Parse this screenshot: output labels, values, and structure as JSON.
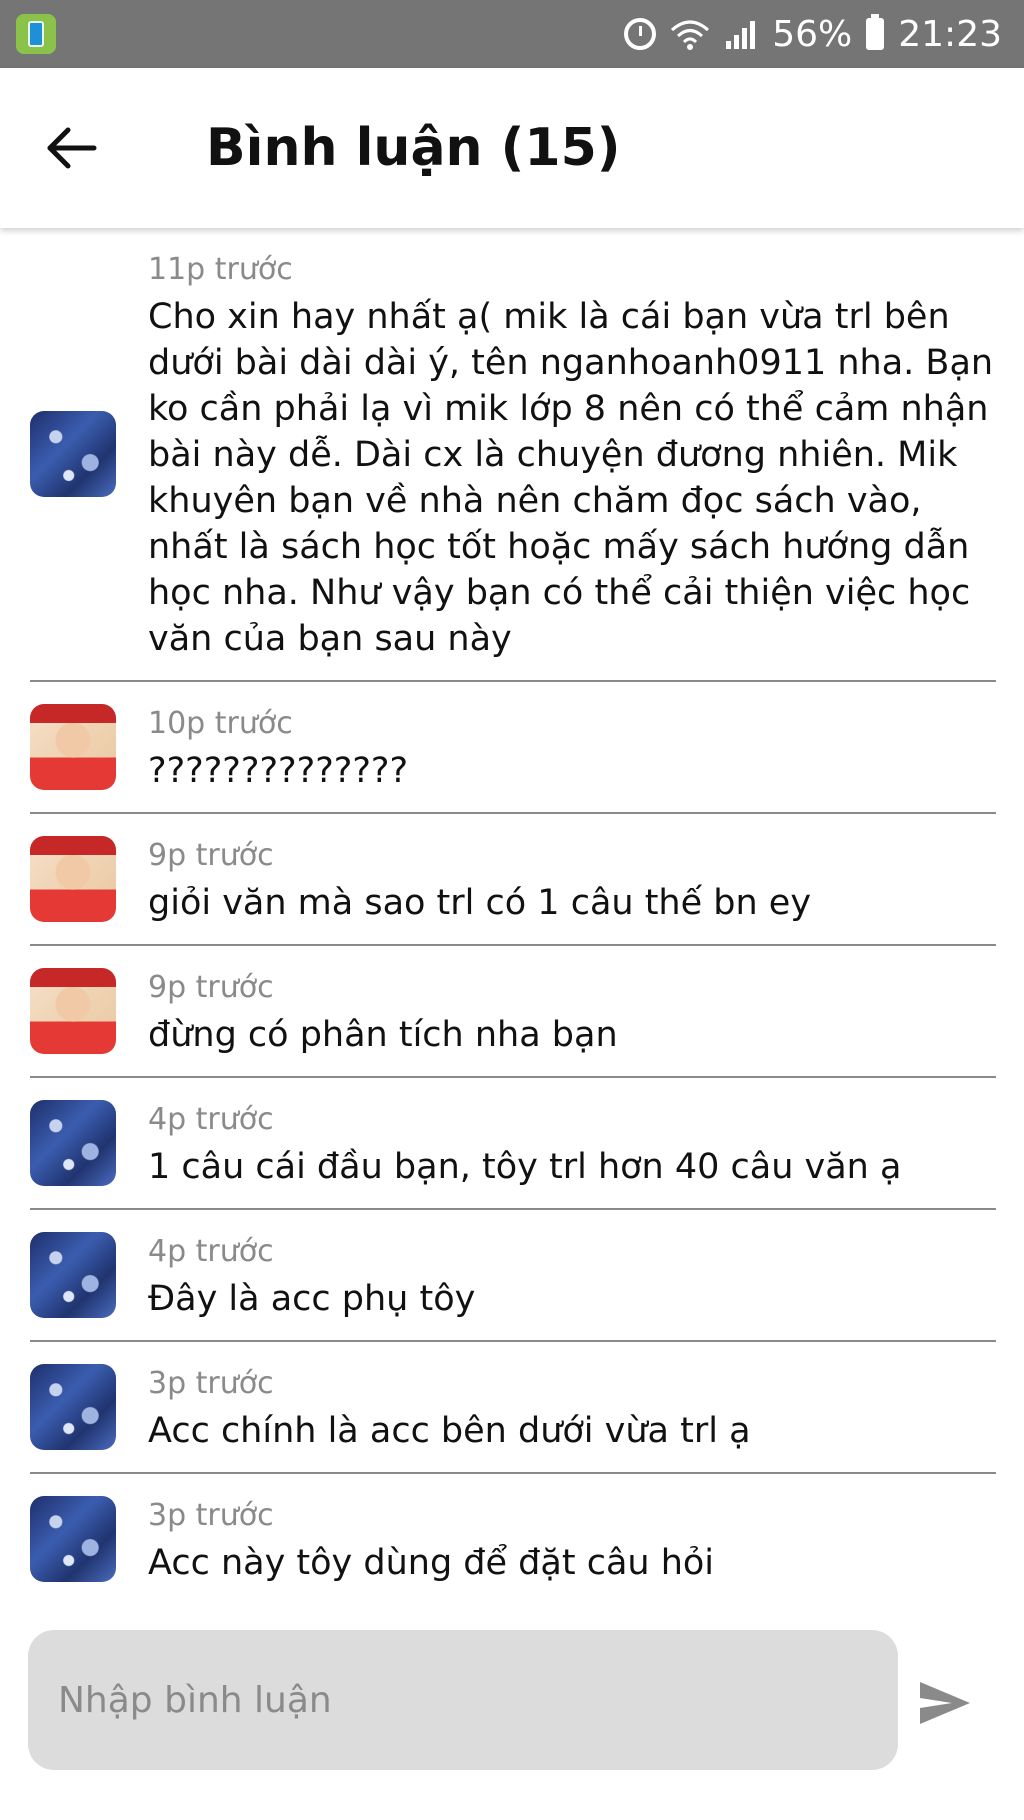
{
  "status_bar": {
    "battery": "56%",
    "time": "21:23",
    "icons": [
      "app-icon",
      "alarm-icon",
      "wifi-icon",
      "signal-icon",
      "battery-icon"
    ]
  },
  "header": {
    "back_icon": "arrow-left-icon",
    "title": "Bình luận (15)"
  },
  "comments": [
    {
      "avatar": "blue-abstract",
      "time": "11p trước",
      "text": "Cho xin hay nhất ạ( mik là cái bạn vừa trl bên dưới bài dài dài ý, tên nganhoanh0911 nha. Bạn ko cần phải lạ vì mik lớp 8 nên có thể cảm nhận bài này dễ. Dài cx là chuyện đương nhiên. Mik khuyên bạn về nhà nên chăm đọc sách vào, nhất là sách học tốt hoặc mấy sách hướng dẫn học nha. Như vậy bạn có thể cải thiện việc học văn của bạn sau này"
    },
    {
      "avatar": "person",
      "time": "10p trước",
      "text": "??????????????"
    },
    {
      "avatar": "person",
      "time": "9p trước",
      "text": "giỏi văn mà sao trl có 1 câu thế bn ey"
    },
    {
      "avatar": "person",
      "time": "9p trước",
      "text": "đừng có phân tích nha bạn"
    },
    {
      "avatar": "blue-abstract",
      "time": "4p trước",
      "text": "1 câu cái đầu bạn, tôy trl hơn 40 câu văn ạ"
    },
    {
      "avatar": "blue-abstract",
      "time": "4p trước",
      "text": "Đây là acc phụ tôy"
    },
    {
      "avatar": "blue-abstract",
      "time": "3p trước",
      "text": "Acc chính là acc bên dưới vừa trl ạ"
    },
    {
      "avatar": "blue-abstract",
      "time": "3p trước",
      "text": "Acc này tôy dùng để đặt câu hỏi"
    }
  ],
  "composer": {
    "placeholder": "Nhập bình luận",
    "value": "",
    "send_icon": "send-icon"
  }
}
